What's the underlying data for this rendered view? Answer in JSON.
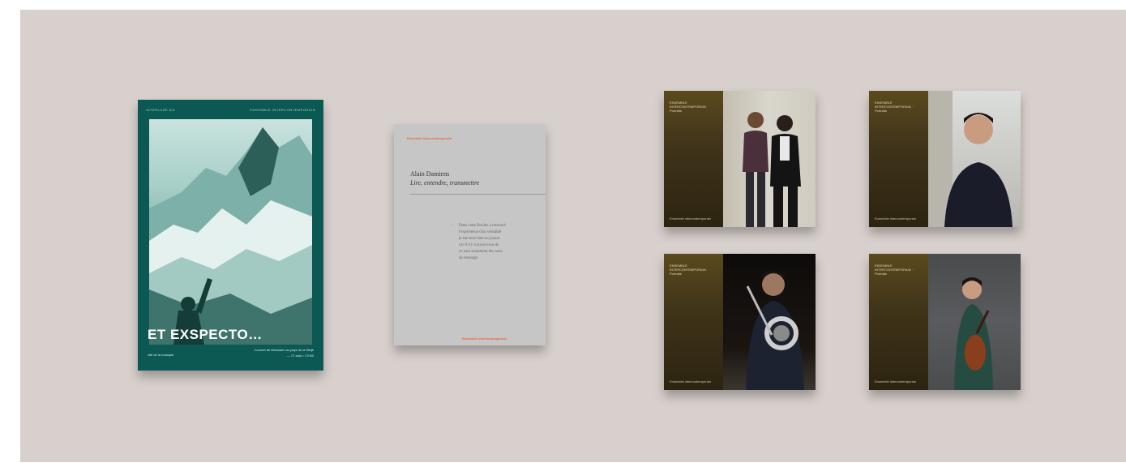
{
  "poster": {
    "header_left": "INTERLUDE 6/8",
    "header_right": "ENSEMBLE INTERCONTEMPORAIN",
    "title": "ET EXSPECTO…",
    "subtitle": "Concert de Messiaen au pays de la Meije",
    "date": "— 17 août • 17h30",
    "logo": "cité de la musique",
    "colors": {
      "background": "#0c5953",
      "title": "#ffffff"
    }
  },
  "leaflet": {
    "brand": "Ensemble intercontemporain",
    "author": "Alain Damiens",
    "work": "Lire, entendre, transmettre",
    "body_lines": [
      "Dans cette Boulez a retrouvé",
      "l'expérience d'un véritable",
      "je me sens bien en jouant",
      "car il n'y a aucun trou de",
      "ce sont seulement des sons",
      "de message."
    ],
    "footer": "Ensemble intercontemporain",
    "colors": {
      "background": "#c6c6c6",
      "accent": "#e8683b"
    }
  },
  "cards": [
    {
      "top_text": "ENSEMBLE INTERCONTEMPORAIN · Portraits",
      "bottom_text": "Ensemble intercontemporain"
    },
    {
      "top_text": "ENSEMBLE INTERCONTEMPORAIN · Portraits",
      "bottom_text": "Ensemble intercontemporain"
    },
    {
      "top_text": "ENSEMBLE INTERCONTEMPORAIN · Portraits",
      "bottom_text": "Ensemble intercontemporain"
    },
    {
      "top_text": "ENSEMBLE INTERCONTEMPORAIN · Portraits",
      "bottom_text": "Ensemble intercontemporain"
    }
  ],
  "colors": {
    "canvas": "#d8d0cc",
    "card_band": "#4a3c18"
  }
}
